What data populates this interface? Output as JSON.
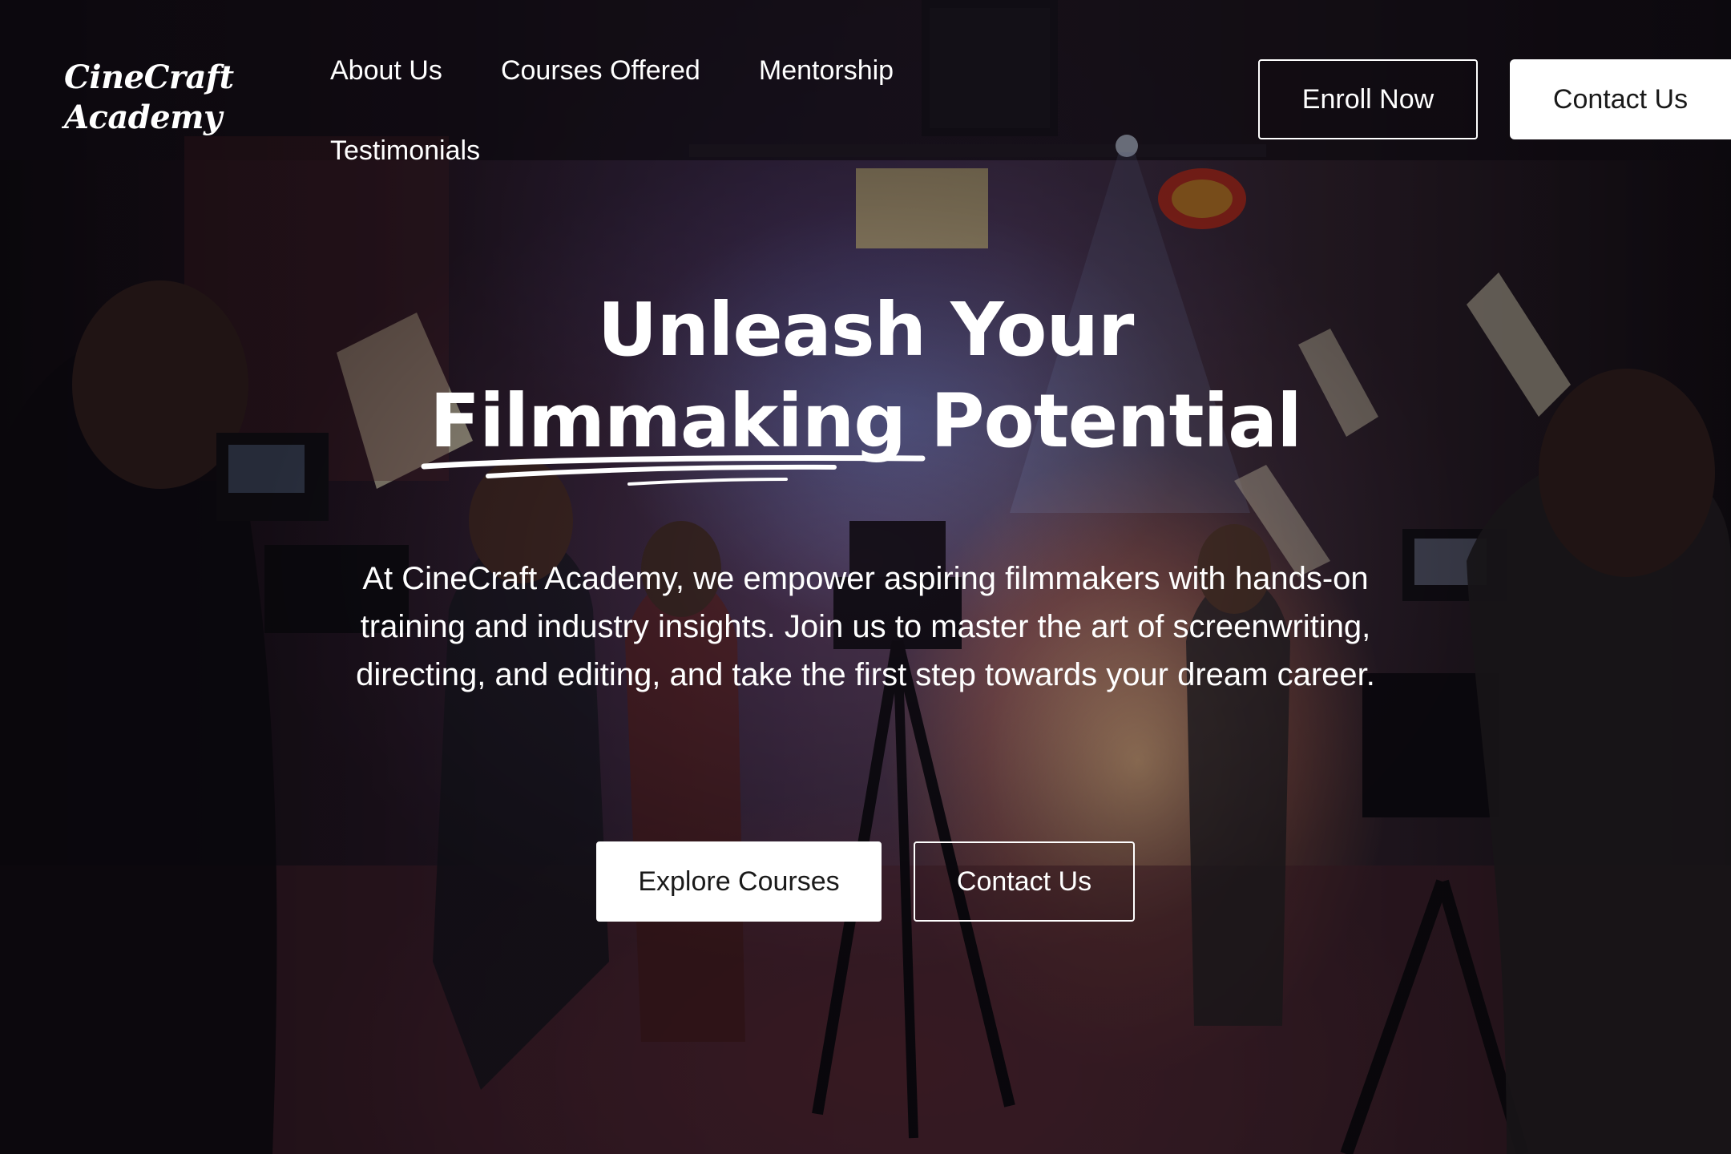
{
  "brand": {
    "logo_line1": "CineCraft",
    "logo_line2": "Academy"
  },
  "nav": {
    "items": [
      {
        "label": "About Us"
      },
      {
        "label": "Courses Offered"
      },
      {
        "label": "Mentorship"
      },
      {
        "label": "Testimonials"
      }
    ],
    "enroll_label": "Enroll Now",
    "contact_label": "Contact Us"
  },
  "hero": {
    "headline_line1": "Unleash Your",
    "headline_word_underlined": "Filmmaking",
    "headline_word_rest": "Potential",
    "subtitle": "At CineCraft Academy, we empower aspiring filmmakers with hands-on training and industry insights. Join us to master the art of screenwriting, directing, and editing, and take the first step towards your dream career.",
    "primary_cta": "Explore Courses",
    "secondary_cta": "Contact Us"
  },
  "colors": {
    "text": "#ffffff",
    "button_solid_bg": "#ffffff",
    "button_solid_text": "#1a1a1a"
  }
}
